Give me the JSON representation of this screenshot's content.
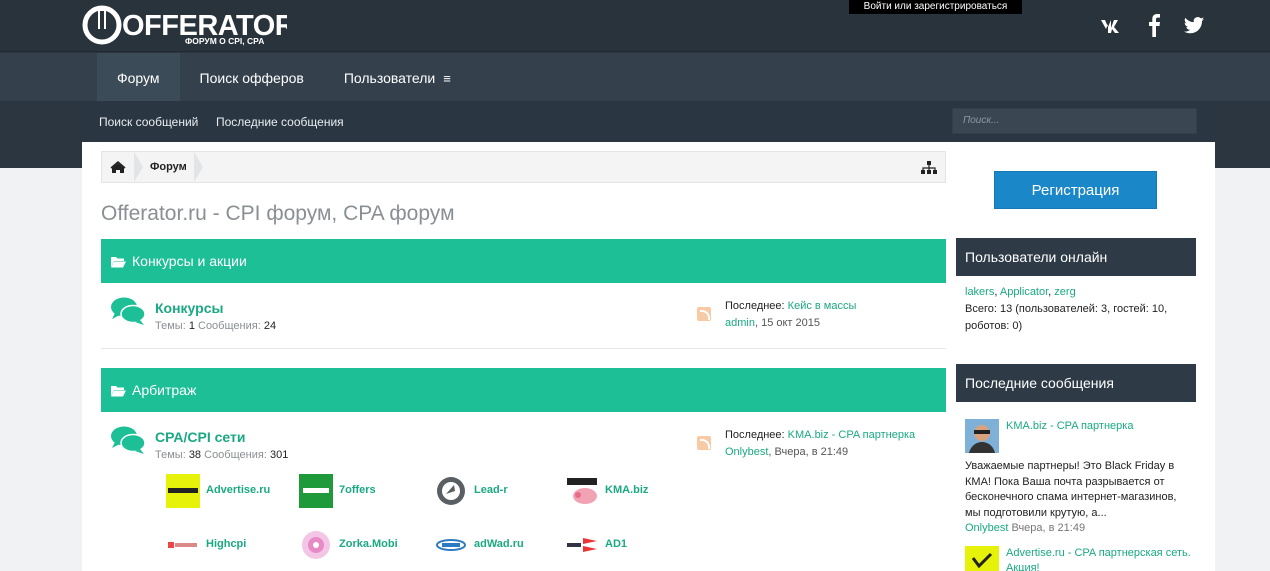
{
  "header": {
    "logo_text": "OFFERATOR",
    "logo_subtitle": "ФОРУМ О CPI, CPA",
    "login_link": "Войти или зарегистрироваться",
    "social_icons": [
      "vk-icon",
      "facebook-icon",
      "twitter-icon"
    ]
  },
  "nav": {
    "tabs": [
      {
        "label": "Форум",
        "active": true
      },
      {
        "label": "Поиск офферов",
        "active": false
      },
      {
        "label": "Пользователи",
        "active": false
      }
    ],
    "menu_glyph": "≡"
  },
  "subnav": {
    "links": [
      "Поиск сообщений",
      "Последние сообщения"
    ],
    "search_placeholder": "Поиск..."
  },
  "breadcrumb": {
    "items": [
      "Форум"
    ]
  },
  "page_title": "Offerator.ru - CPI форум, CPA форум",
  "categories": [
    {
      "title": "Конкурсы и акции",
      "forums": [
        {
          "title": "Конкурсы",
          "threads_label": "Темы:",
          "threads": "1",
          "messages_label": "Сообщения:",
          "messages": "24",
          "last_label": "Последнее:",
          "last_title": "Кейс в массы",
          "last_user": "admin",
          "last_date": ", 15 окт 2015"
        }
      ]
    },
    {
      "title": "Арбитраж",
      "forums": [
        {
          "title": "CPA/CPI сети",
          "threads_label": "Темы:",
          "threads": "38",
          "messages_label": "Сообщения:",
          "messages": "301",
          "last_label": "Последнее:",
          "last_title": "KMA.biz - CPA партнерка",
          "last_user": "Onlybest",
          "last_date": ", Вчера, в 21:49",
          "subforums": [
            "Advertise.ru",
            "7offers",
            "Lead-r",
            "KMA.biz",
            "Highcpi",
            "Zorka.Mobi",
            "adWad.ru",
            "AD1"
          ]
        }
      ]
    }
  ],
  "sidebar": {
    "register_button": "Регистрация",
    "online": {
      "title": "Пользователи онлайн",
      "users": [
        "lakers",
        "Applicator",
        "zerg"
      ],
      "total_line1": "Всего: 13 (пользователей: 3, гостей: 10,",
      "total_line2": "роботов: 0)"
    },
    "latest": {
      "title": "Последние сообщения",
      "items": [
        {
          "title": "KMA.biz - CPA партнерка",
          "excerpt": "Уважаемые партнеры! Это Black Friday в КМА! Пока Ваша почта разрывается от бесконечного спама интернет-магазинов, мы подготовили крутую, а...",
          "user": "Onlybest",
          "date": " Вчера, в 21:49"
        },
        {
          "title": "Advertise.ru - CPA партнерская сеть. Акция!"
        }
      ]
    }
  },
  "colors": {
    "accent": "#1dbf97",
    "link": "#1aa983",
    "dark": "#2b3640",
    "button": "#1a87c9"
  }
}
